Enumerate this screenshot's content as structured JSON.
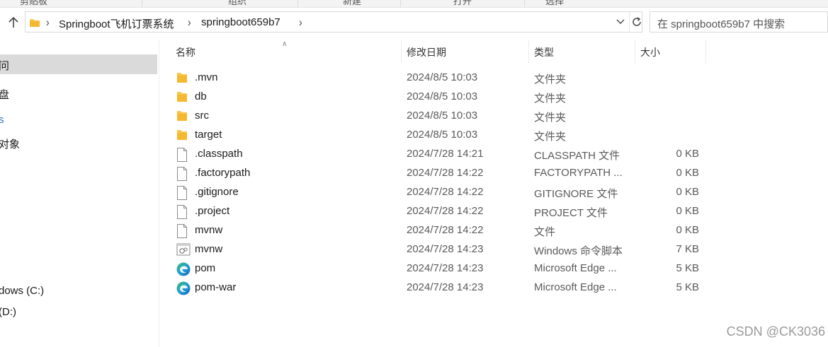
{
  "ribbon": {
    "items": [
      "剪贴板",
      "组织",
      "新建",
      "打开",
      "选择"
    ]
  },
  "address": {
    "crumbs": [
      "Springboot飞机订票系统",
      "springboot659b7"
    ]
  },
  "search": {
    "placeholder": "在 springboot659b7 中搜索"
  },
  "nav": {
    "items": [
      {
        "label": "问",
        "selected": true
      },
      {
        "label": "盘"
      },
      {
        "label": "s"
      },
      {
        "label": "对象"
      },
      {
        "label": "dows (C:)"
      },
      {
        "label": "(D:)"
      }
    ]
  },
  "columns": {
    "name": "名称",
    "date": "修改日期",
    "type": "类型",
    "size": "大小"
  },
  "files": [
    {
      "name": ".mvn",
      "date": "2024/8/5 10:03",
      "type": "文件夹",
      "size": "",
      "icon": "folder-icon"
    },
    {
      "name": "db",
      "date": "2024/8/5 10:03",
      "type": "文件夹",
      "size": "",
      "icon": "folder-icon"
    },
    {
      "name": "src",
      "date": "2024/8/5 10:03",
      "type": "文件夹",
      "size": "",
      "icon": "folder-icon"
    },
    {
      "name": "target",
      "date": "2024/8/5 10:03",
      "type": "文件夹",
      "size": "",
      "icon": "folder-icon"
    },
    {
      "name": ".classpath",
      "date": "2024/7/28 14:21",
      "type": "CLASSPATH 文件",
      "size": "0 KB",
      "icon": "file-icon"
    },
    {
      "name": ".factorypath",
      "date": "2024/7/28 14:22",
      "type": "FACTORYPATH ...",
      "size": "0 KB",
      "icon": "file-icon"
    },
    {
      "name": ".gitignore",
      "date": "2024/7/28 14:22",
      "type": "GITIGNORE 文件",
      "size": "0 KB",
      "icon": "file-icon"
    },
    {
      "name": ".project",
      "date": "2024/7/28 14:22",
      "type": "PROJECT 文件",
      "size": "0 KB",
      "icon": "file-icon"
    },
    {
      "name": "mvnw",
      "date": "2024/7/28 14:22",
      "type": "文件",
      "size": "0 KB",
      "icon": "file-icon"
    },
    {
      "name": "mvnw",
      "date": "2024/7/28 14:23",
      "type": "Windows 命令脚本",
      "size": "7 KB",
      "icon": "script-icon"
    },
    {
      "name": "pom",
      "date": "2024/7/28 14:23",
      "type": "Microsoft Edge ...",
      "size": "5 KB",
      "icon": "edge-icon"
    },
    {
      "name": "pom-war",
      "date": "2024/7/28 14:23",
      "type": "Microsoft Edge ...",
      "size": "5 KB",
      "icon": "edge-icon"
    }
  ],
  "watermark": "CSDN @CK3036",
  "colors": {
    "folder": "#f8c64b",
    "selected_nav": "#dadada",
    "edge_blue": "#1e77d3",
    "edge_green": "#3fbf6f"
  }
}
